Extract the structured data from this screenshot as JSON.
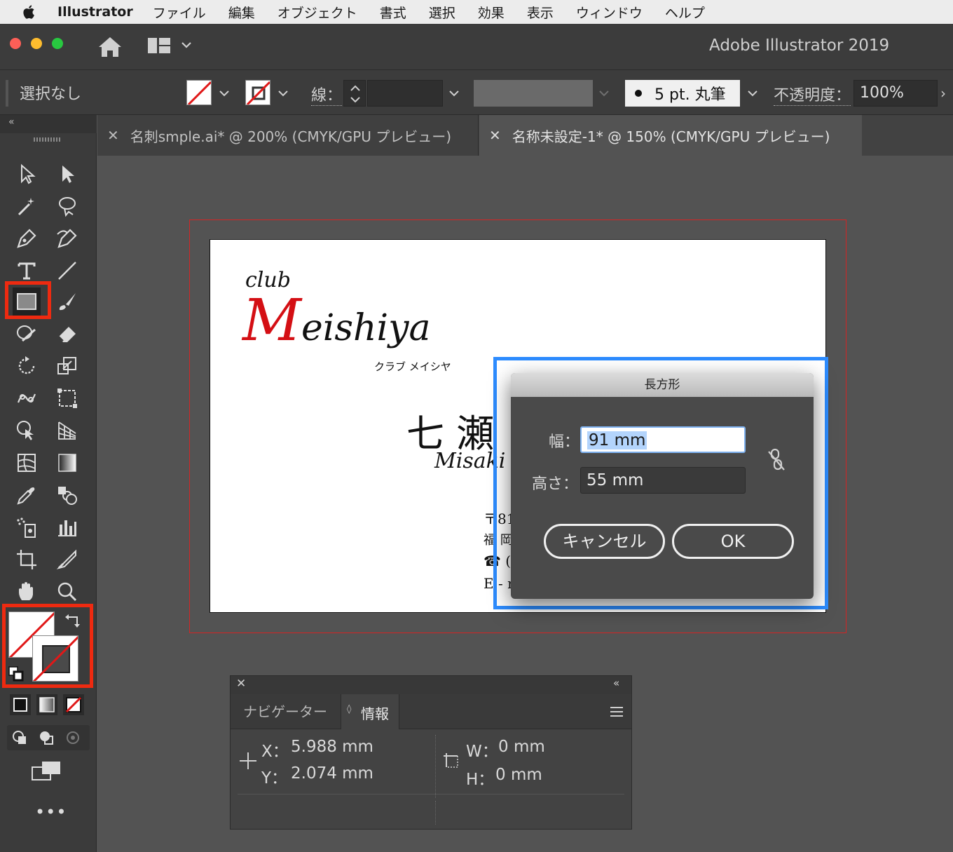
{
  "menubar": {
    "app_name": "Illustrator",
    "items": [
      "ファイル",
      "編集",
      "オブジェクト",
      "書式",
      "選択",
      "効果",
      "表示",
      "ウィンドウ",
      "ヘルプ"
    ]
  },
  "titlebar": {
    "title": "Adobe Illustrator 2019"
  },
  "controlbar": {
    "selection_label": "選択なし",
    "stroke_label": "線：",
    "brush_value": "5 pt. 丸筆",
    "opacity_label": "不透明度：",
    "opacity_value": "100%"
  },
  "tabs": [
    {
      "label": "名刺smple.ai* @ 200% (CMYK/GPU プレビュー)",
      "active": false
    },
    {
      "label": "名称未設定-1* @ 150% (CMYK/GPU プレビュー)",
      "active": true
    }
  ],
  "card": {
    "club": "club",
    "logo": "Meishiya",
    "logo_initial": "M",
    "logo_rest": "eishiya",
    "logo_kana": "クラブ メイシヤ",
    "name_visible": "七 瀬",
    "romaji_visible": "Misaki",
    "addr_line1": "〒81",
    "addr_line2": "福 岡",
    "addr_line3": "☎ (",
    "addr_line4": "E - m"
  },
  "dialog": {
    "title": "長方形",
    "width_label": "幅：",
    "width_value": "91 mm",
    "height_label": "高さ：",
    "height_value": "55 mm",
    "cancel_label": "キャンセル",
    "ok_label": "OK"
  },
  "info_panel": {
    "tabs": [
      "ナビゲーター",
      "情報"
    ],
    "x_label": "X：",
    "x_value": "5.988 mm",
    "y_label": "Y：",
    "y_value": "2.074 mm",
    "w_label": "W：",
    "w_value": "0 mm",
    "h_label": "H：",
    "h_value": "0 mm"
  },
  "colors": {
    "highlight_red": "#ee2a10",
    "highlight_blue": "#2d8cff",
    "logo_red": "#d40f14",
    "artboard_bleed": "#d32525"
  }
}
